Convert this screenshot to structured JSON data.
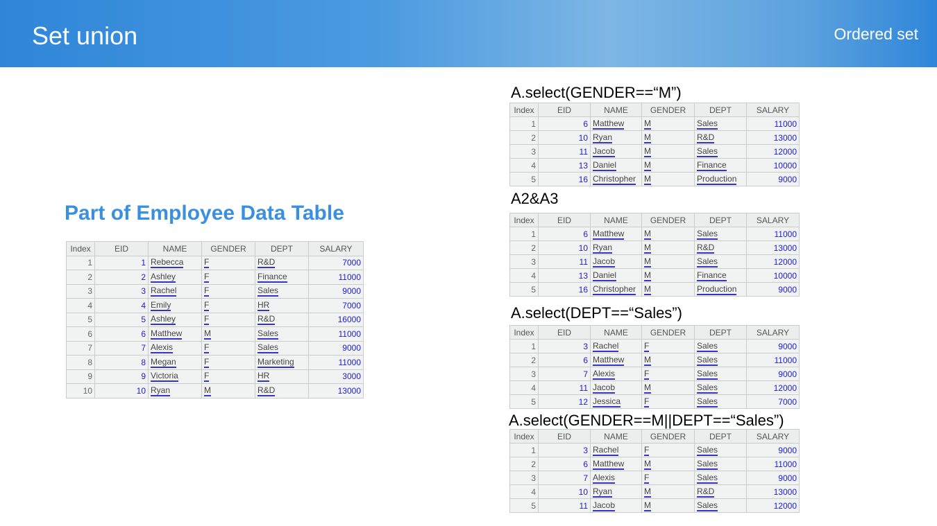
{
  "header": {
    "title": "Set union",
    "section": "Ordered set"
  },
  "heading": "Part of Employee Data Table",
  "columns": [
    "Index",
    "EID",
    "NAME",
    "GENDER",
    "DEPT",
    "SALARY"
  ],
  "tables": [
    {
      "label": "",
      "rows": [
        [
          1,
          1,
          "Rebecca",
          "F",
          "R&D",
          7000
        ],
        [
          2,
          2,
          "Ashley",
          "F",
          "Finance",
          11000
        ],
        [
          3,
          3,
          "Rachel",
          "F",
          "Sales",
          9000
        ],
        [
          4,
          4,
          "Emily",
          "F",
          "HR",
          7000
        ],
        [
          5,
          5,
          "Ashley",
          "F",
          "R&D",
          16000
        ],
        [
          6,
          6,
          "Matthew",
          "M",
          "Sales",
          11000
        ],
        [
          7,
          7,
          "Alexis",
          "F",
          "Sales",
          9000
        ],
        [
          8,
          8,
          "Megan",
          "F",
          "Marketing",
          11000
        ],
        [
          9,
          9,
          "Victoria",
          "F",
          "HR",
          3000
        ],
        [
          10,
          10,
          "Ryan",
          "M",
          "R&D",
          13000
        ]
      ]
    },
    {
      "label": "A.select(GENDER==“M”)",
      "rows": [
        [
          1,
          6,
          "Matthew",
          "M",
          "Sales",
          11000
        ],
        [
          2,
          10,
          "Ryan",
          "M",
          "R&D",
          13000
        ],
        [
          3,
          11,
          "Jacob",
          "M",
          "Sales",
          12000
        ],
        [
          4,
          13,
          "Daniel",
          "M",
          "Finance",
          10000
        ],
        [
          5,
          16,
          "Christopher",
          "M",
          "Production",
          9000
        ]
      ]
    },
    {
      "label": "A2&A3",
      "rows": [
        [
          1,
          6,
          "Matthew",
          "M",
          "Sales",
          11000
        ],
        [
          2,
          10,
          "Ryan",
          "M",
          "R&D",
          13000
        ],
        [
          3,
          11,
          "Jacob",
          "M",
          "Sales",
          12000
        ],
        [
          4,
          13,
          "Daniel",
          "M",
          "Finance",
          10000
        ],
        [
          5,
          16,
          "Christopher",
          "M",
          "Production",
          9000
        ]
      ]
    },
    {
      "label": "A.select(DEPT==“Sales”)",
      "rows": [
        [
          1,
          3,
          "Rachel",
          "F",
          "Sales",
          9000
        ],
        [
          2,
          6,
          "Matthew",
          "M",
          "Sales",
          11000
        ],
        [
          3,
          7,
          "Alexis",
          "F",
          "Sales",
          9000
        ],
        [
          4,
          11,
          "Jacob",
          "M",
          "Sales",
          12000
        ],
        [
          5,
          12,
          "Jessica",
          "F",
          "Sales",
          7000
        ]
      ]
    },
    {
      "label": "A.select(GENDER==M||DEPT==“Sales”)",
      "rows": [
        [
          1,
          3,
          "Rachel",
          "F",
          "Sales",
          9000
        ],
        [
          2,
          6,
          "Matthew",
          "M",
          "Sales",
          11000
        ],
        [
          3,
          7,
          "Alexis",
          "F",
          "Sales",
          9000
        ],
        [
          4,
          10,
          "Ryan",
          "M",
          "R&D",
          13000
        ],
        [
          5,
          11,
          "Jacob",
          "M",
          "Sales",
          12000
        ]
      ]
    }
  ]
}
